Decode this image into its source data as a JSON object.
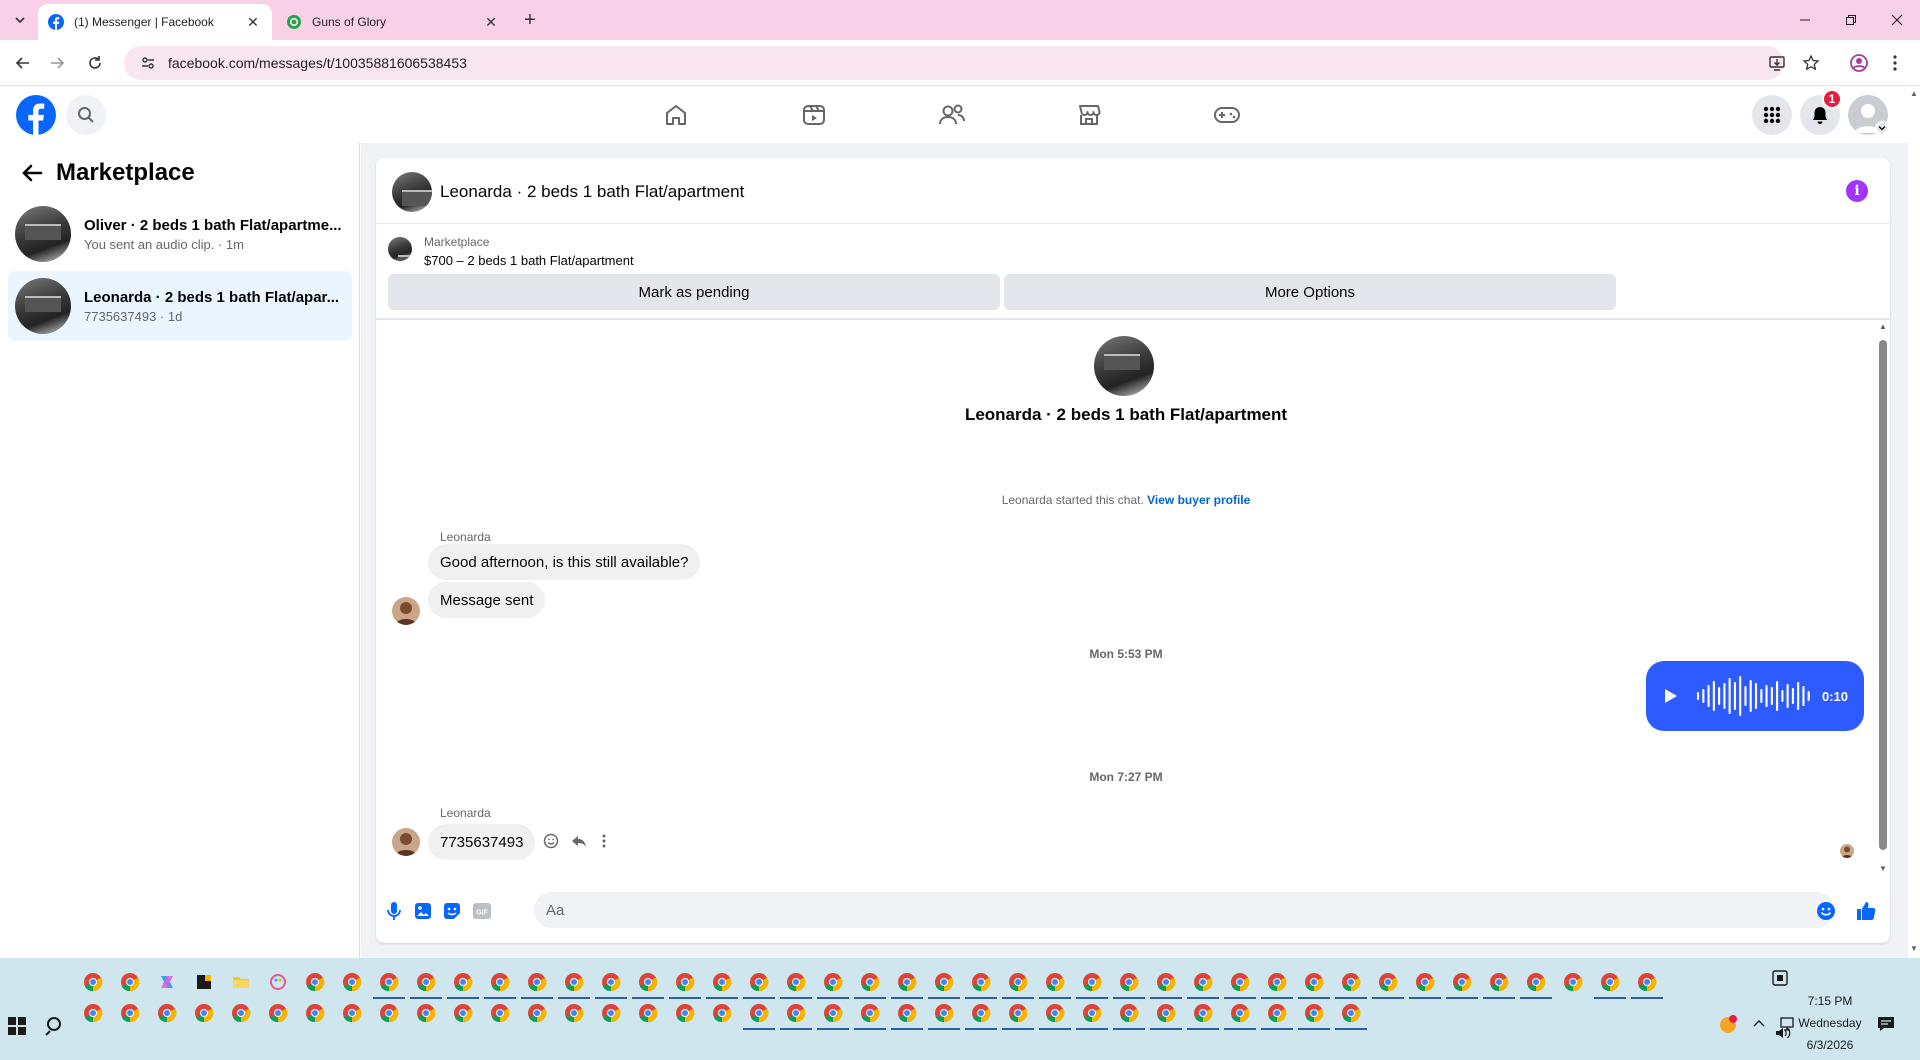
{
  "browser": {
    "tabs": [
      {
        "title": "(1) Messenger | Facebook",
        "active": true,
        "icon": "facebook-icon"
      },
      {
        "title": "Guns of Glory",
        "active": false,
        "icon": "globe-icon"
      }
    ],
    "url": "facebook.com/messages/t/10035881606538453"
  },
  "fb_nav": {
    "notification_count": "1",
    "accent": "#0866ff",
    "icons": [
      "home-icon",
      "video-icon",
      "friends-icon",
      "marketplace-icon",
      "gaming-icon"
    ]
  },
  "sidebar": {
    "title": "Marketplace",
    "threads": [
      {
        "name": "Oliver · 2 beds 1 bath Flat/apartme...",
        "subtitle": "You sent an audio clip. · 1m",
        "selected": false
      },
      {
        "name": "Leonarda · 2 beds 1 bath Flat/apar...",
        "subtitle": "7735637493 · 1d",
        "selected": true
      }
    ]
  },
  "chat": {
    "header_title": "Leonarda · 2 beds 1 bath Flat/apartment",
    "listing": {
      "label": "Marketplace",
      "price_title": "$700 – 2 beds 1 bath Flat/apartment"
    },
    "buttons": {
      "mark_pending": "Mark as pending",
      "more_options": "More Options"
    },
    "center_name": "Leonarda · 2 beds 1 bath Flat/apartment",
    "started_text": "Leonarda started this chat.",
    "view_profile": "View buyer profile",
    "messages": [
      {
        "sender": "Leonarda",
        "text": "Good afternoon, is this still available?"
      },
      {
        "text": "Message sent"
      }
    ],
    "timestamp1": "Mon 5:53 PM",
    "audio_duration": "0:10",
    "timestamp2": "Mon 7:27 PM",
    "last_sender": "Leonarda",
    "last_message": "7735637493",
    "composer_placeholder": "Aa",
    "audio_color": "#2e5bff"
  },
  "taskbar": {
    "time": "7:15 PM",
    "day": "Wednesday",
    "date": "6/3/2026"
  }
}
